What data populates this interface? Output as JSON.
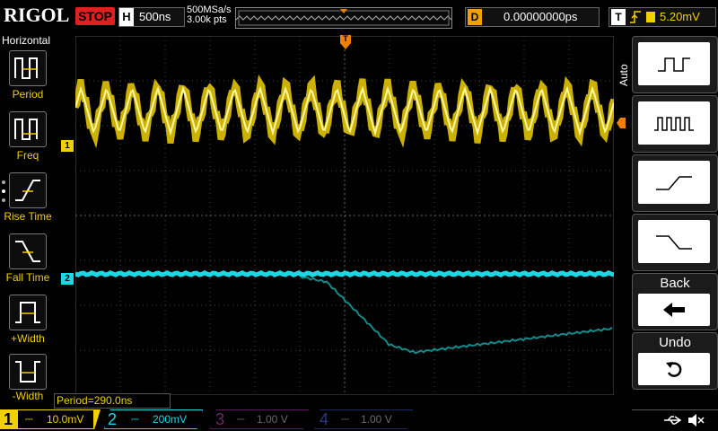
{
  "header": {
    "brand": "RIGOL",
    "run_state": "STOP",
    "horizontal": {
      "letter": "H",
      "timebase": "500ns",
      "sample_rate": "500MSa/s",
      "points": "3.00k pts"
    },
    "delay": {
      "letter": "D",
      "value": "0.00000000ps"
    },
    "trigger": {
      "letter": "T",
      "level": "5.20mV"
    }
  },
  "left_menu": {
    "title": "Horizontal",
    "items": [
      {
        "label": "Period"
      },
      {
        "label": "Freq"
      },
      {
        "label": "Rise Time"
      },
      {
        "label": "Fall Time"
      },
      {
        "label": "+Width"
      },
      {
        "label": "-Width"
      }
    ]
  },
  "scope": {
    "trigger_marker": "T",
    "ch1_marker": "1",
    "ch2_marker": "2",
    "measurement": "Period=290.0ns"
  },
  "right_menu": {
    "auto_label": "Auto",
    "back_label": "Back",
    "undo_label": "Undo"
  },
  "channels": [
    {
      "num": "1",
      "scale": "10.0mV",
      "color": "#f0d000"
    },
    {
      "num": "2",
      "scale": "200mV",
      "color": "#00c8e0"
    },
    {
      "num": "3",
      "scale": "1.00 V",
      "color": "#c020c0"
    },
    {
      "num": "4",
      "scale": "1.00 V",
      "color": "#3060e0"
    }
  ],
  "colors": {
    "ch1": "#f0d000",
    "ch2": "#19d9e6",
    "accent": "#f08000",
    "stop": "#e02020"
  }
}
